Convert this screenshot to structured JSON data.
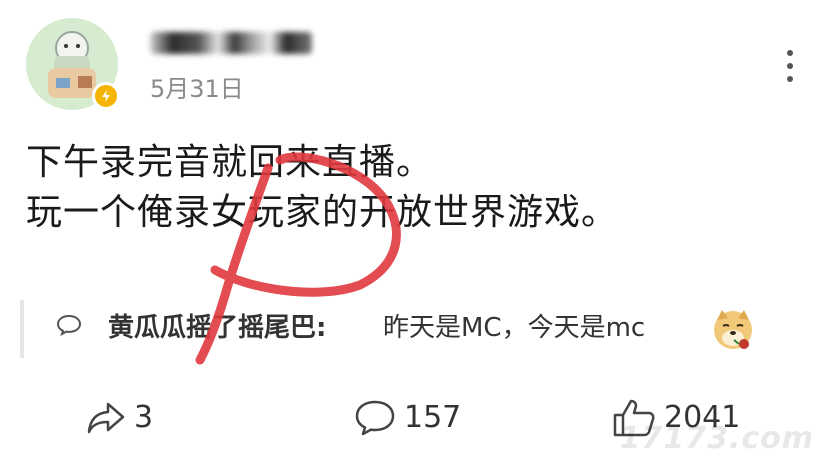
{
  "post": {
    "username": "",
    "date": "5月31日",
    "lines": [
      "下午录完音就回来直播。",
      "玩一个俺录女玩家的开放世界游戏。"
    ]
  },
  "repost": {
    "author": "黄瓜瓜摇了摇尾巴:",
    "text": "昨天是MC，今天是mc"
  },
  "actions": {
    "share_count": "3",
    "comment_count": "157",
    "like_count": "2041"
  },
  "watermark": "17173.com",
  "icons": {
    "avatar": "avatar-illustration",
    "badge": "lightning-badge-icon",
    "more": "more-vertical-icon",
    "repost_comment": "comment-bubble-icon",
    "emoji": "doge-emoji",
    "share": "share-arrow-icon",
    "comment": "comment-icon",
    "like": "thumbs-up-icon"
  },
  "colors": {
    "badge": "#f5b400",
    "date": "#8a8a8a",
    "red_mark": "#e0383e",
    "divider": "#e6e6e6"
  }
}
